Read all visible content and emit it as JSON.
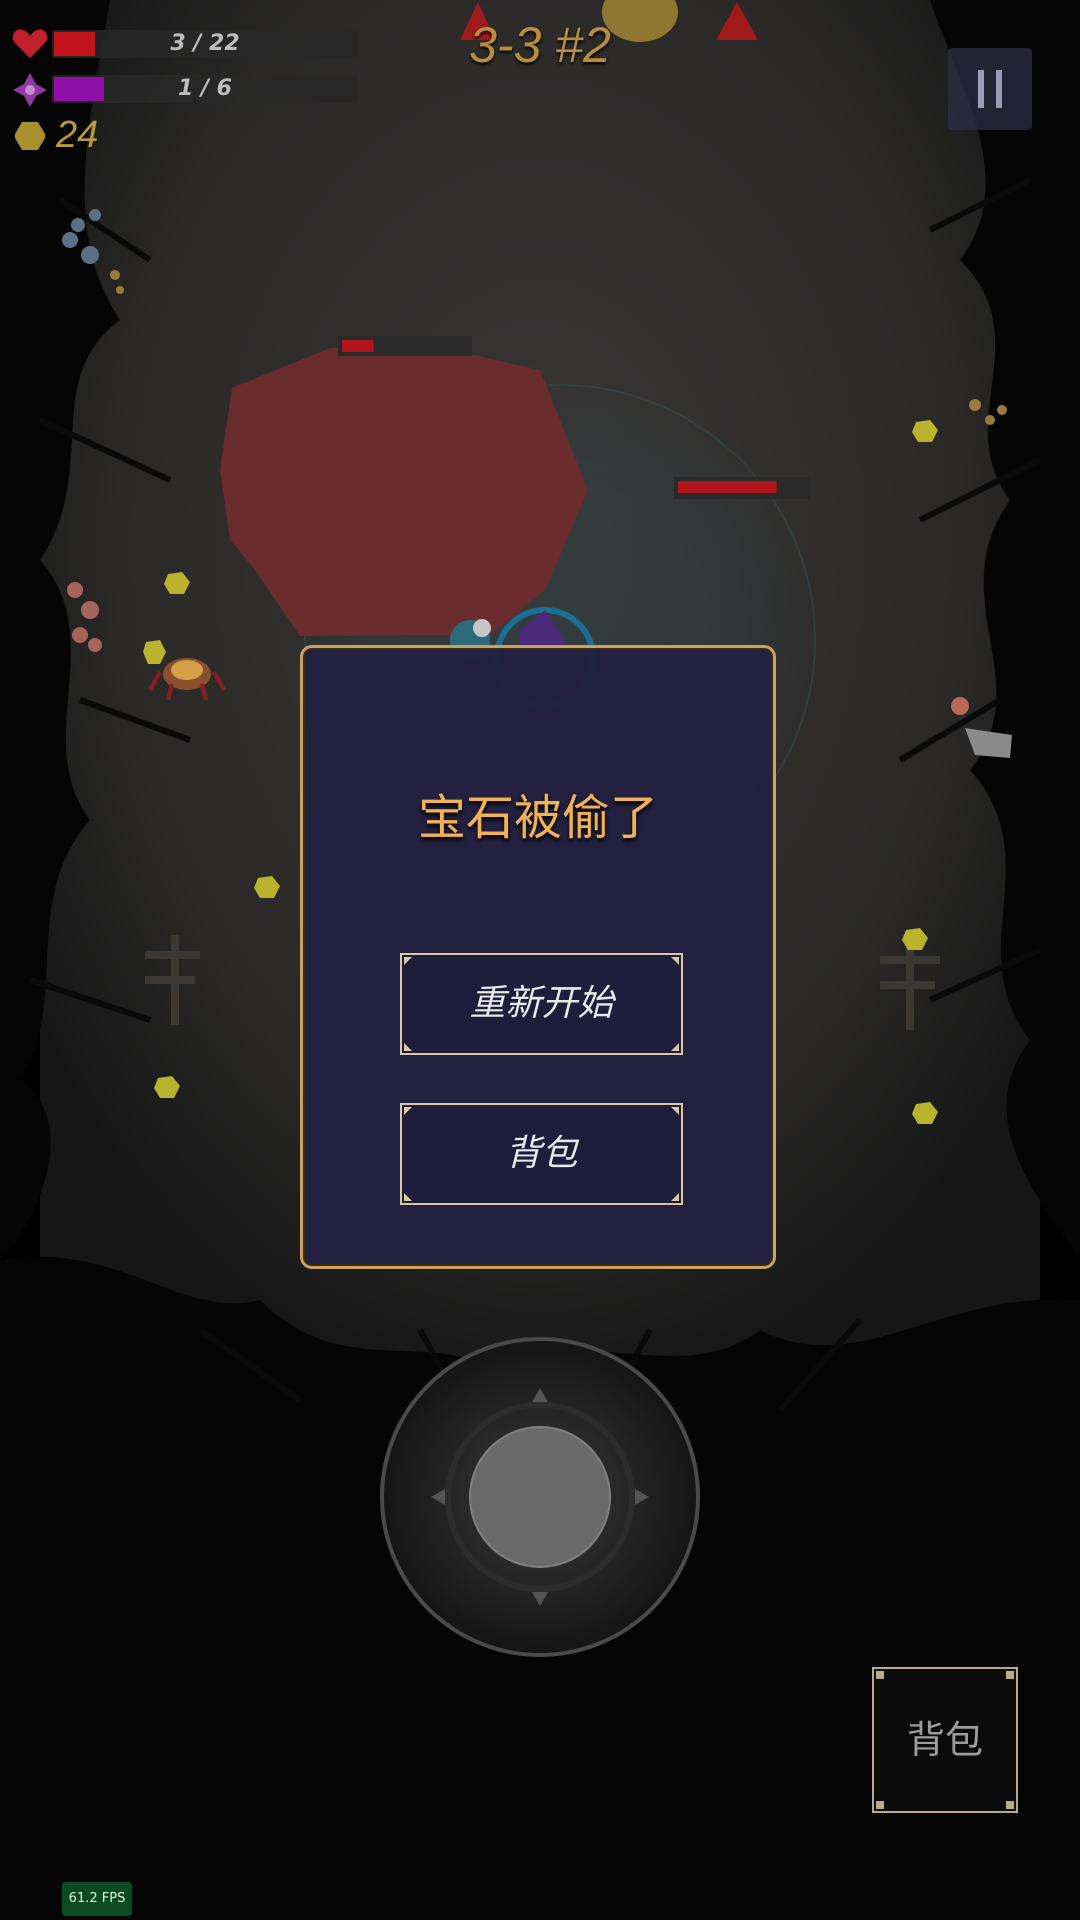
{
  "hud": {
    "health": {
      "current": 3,
      "max": 22,
      "text": "3 / 22",
      "color": "#c0131c"
    },
    "mana": {
      "current": 1,
      "max": 6,
      "text": "1 / 6",
      "color": "#8e10a8"
    },
    "coins": "24",
    "level_title": "3-3 #2"
  },
  "enemies": [
    {
      "name": "boss",
      "health_fraction": 0.25
    },
    {
      "name": "enemy",
      "health_fraction": 0.77
    }
  ],
  "dialog": {
    "title": "宝石被偷了",
    "restart_label": "重新开始",
    "backpack_label": "背包"
  },
  "backpack_button": {
    "label": "背包"
  },
  "fps": "61.2 FPS",
  "icons": {
    "health": "heart-icon",
    "mana": "mana-star-icon",
    "coin": "coin-icon",
    "pause": "pause-icon"
  }
}
